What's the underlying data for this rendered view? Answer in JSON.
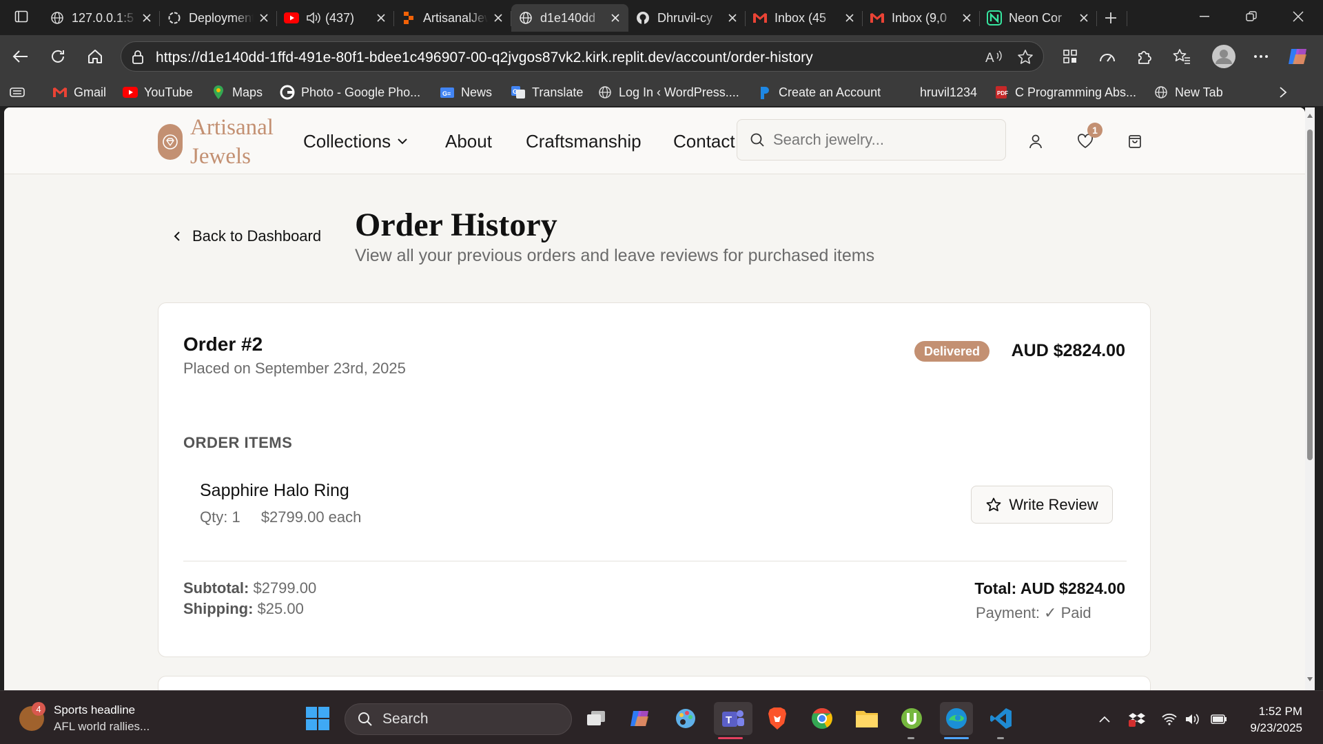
{
  "browser": {
    "tabs": [
      {
        "title": "127.0.0.1:5",
        "icon": "globe-icon"
      },
      {
        "title": "Deployments",
        "icon": "openai-icon"
      },
      {
        "title": "(437)",
        "icon": "youtube-icon"
      },
      {
        "title": "ArtisanalJewels",
        "icon": "replit-icon"
      },
      {
        "title": "d1e140dd",
        "icon": "globe-icon",
        "active": true
      },
      {
        "title": "Dhruvil-cy",
        "icon": "github-icon"
      },
      {
        "title": "Inbox (45",
        "icon": "gmail-icon"
      },
      {
        "title": "Inbox (9,0",
        "icon": "gmail-icon"
      },
      {
        "title": "Neon Cor",
        "icon": "neon-icon"
      }
    ],
    "url": "https://d1e140dd-1ffd-491e-80f1-bdee1c496907-00-q2jvgos87vk2.kirk.replit.dev/account/order-history",
    "bookmarks": [
      {
        "label": "Gmail",
        "icon": "gmail-icon"
      },
      {
        "label": "YouTube",
        "icon": "youtube-icon"
      },
      {
        "label": "Maps",
        "icon": "maps-icon"
      },
      {
        "label": "Photo - Google Pho...",
        "icon": "google-icon"
      },
      {
        "label": "News",
        "icon": "news-icon"
      },
      {
        "label": "Translate",
        "icon": "translate-icon"
      },
      {
        "label": "Log In ‹ WordPress....",
        "icon": "globe-icon"
      },
      {
        "label": "Create an Account",
        "icon": "pexels-icon"
      },
      {
        "label": "hruvil1234",
        "icon": "none"
      },
      {
        "label": "C Programming Abs...",
        "icon": "pdf-icon"
      },
      {
        "label": "New Tab",
        "icon": "globe-icon"
      }
    ]
  },
  "site": {
    "brand_line1": "Artisanal",
    "brand_line2": "Jewels",
    "nav": {
      "collections": "Collections",
      "about": "About",
      "craftsmanship": "Craftsmanship",
      "contact": "Contact"
    },
    "search_placeholder": "Search jewelry...",
    "wishlist_count": "1",
    "accent_color": "#c39072"
  },
  "page": {
    "back_label": "Back to Dashboard",
    "title": "Order History",
    "subtitle": "View all your previous orders and leave reviews for purchased items"
  },
  "orders": [
    {
      "number": "Order #2",
      "placed": "Placed on September 23rd, 2025",
      "status": "Delivered",
      "total_header": "AUD $2824.00",
      "items_heading": "ORDER ITEMS",
      "items": [
        {
          "name": "Sapphire Halo Ring",
          "qty": "Qty: 1",
          "price": "$2799.00 each",
          "review_label": "Write Review"
        }
      ],
      "subtotal_label": "Subtotal:",
      "subtotal_value": "$2799.00",
      "shipping_label": "Shipping:",
      "shipping_value": "$25.00",
      "total_line": "Total: AUD $2824.00",
      "payment_line": "Payment: ✓ Paid"
    }
  ],
  "taskbar": {
    "news_count": "4",
    "news_title": "Sports headline",
    "news_sub": "AFL world rallies...",
    "search_label": "Search",
    "time": "1:52 PM",
    "date": "9/23/2025"
  }
}
